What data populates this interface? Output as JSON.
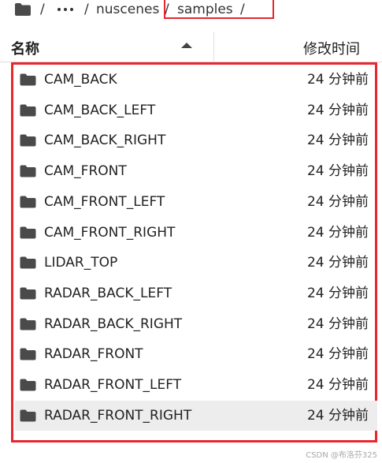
{
  "breadcrumb": {
    "separator": "/",
    "segments": [
      "nuscenes",
      "samples"
    ]
  },
  "header": {
    "name_label": "名称",
    "modified_label": "修改时间"
  },
  "files": [
    {
      "name": "CAM_BACK",
      "modified": "24 分钟前"
    },
    {
      "name": "CAM_BACK_LEFT",
      "modified": "24 分钟前"
    },
    {
      "name": "CAM_BACK_RIGHT",
      "modified": "24 分钟前"
    },
    {
      "name": "CAM_FRONT",
      "modified": "24 分钟前"
    },
    {
      "name": "CAM_FRONT_LEFT",
      "modified": "24 分钟前"
    },
    {
      "name": "CAM_FRONT_RIGHT",
      "modified": "24 分钟前"
    },
    {
      "name": "LIDAR_TOP",
      "modified": "24 分钟前"
    },
    {
      "name": "RADAR_BACK_LEFT",
      "modified": "24 分钟前"
    },
    {
      "name": "RADAR_BACK_RIGHT",
      "modified": "24 分钟前"
    },
    {
      "name": "RADAR_FRONT",
      "modified": "24 分钟前"
    },
    {
      "name": "RADAR_FRONT_LEFT",
      "modified": "24 分钟前"
    },
    {
      "name": "RADAR_FRONT_RIGHT",
      "modified": "24 分钟前"
    }
  ],
  "icons": {
    "home": "folder-icon",
    "more": "ellipsis-icon",
    "sort": "sort-ascending-icon",
    "row": "folder-icon"
  },
  "colors": {
    "highlight_box": "#e8262d",
    "folder_icon": "#4a4a4a",
    "selected_row": "#ededed"
  },
  "watermark": "CSDN @布洛芬325"
}
